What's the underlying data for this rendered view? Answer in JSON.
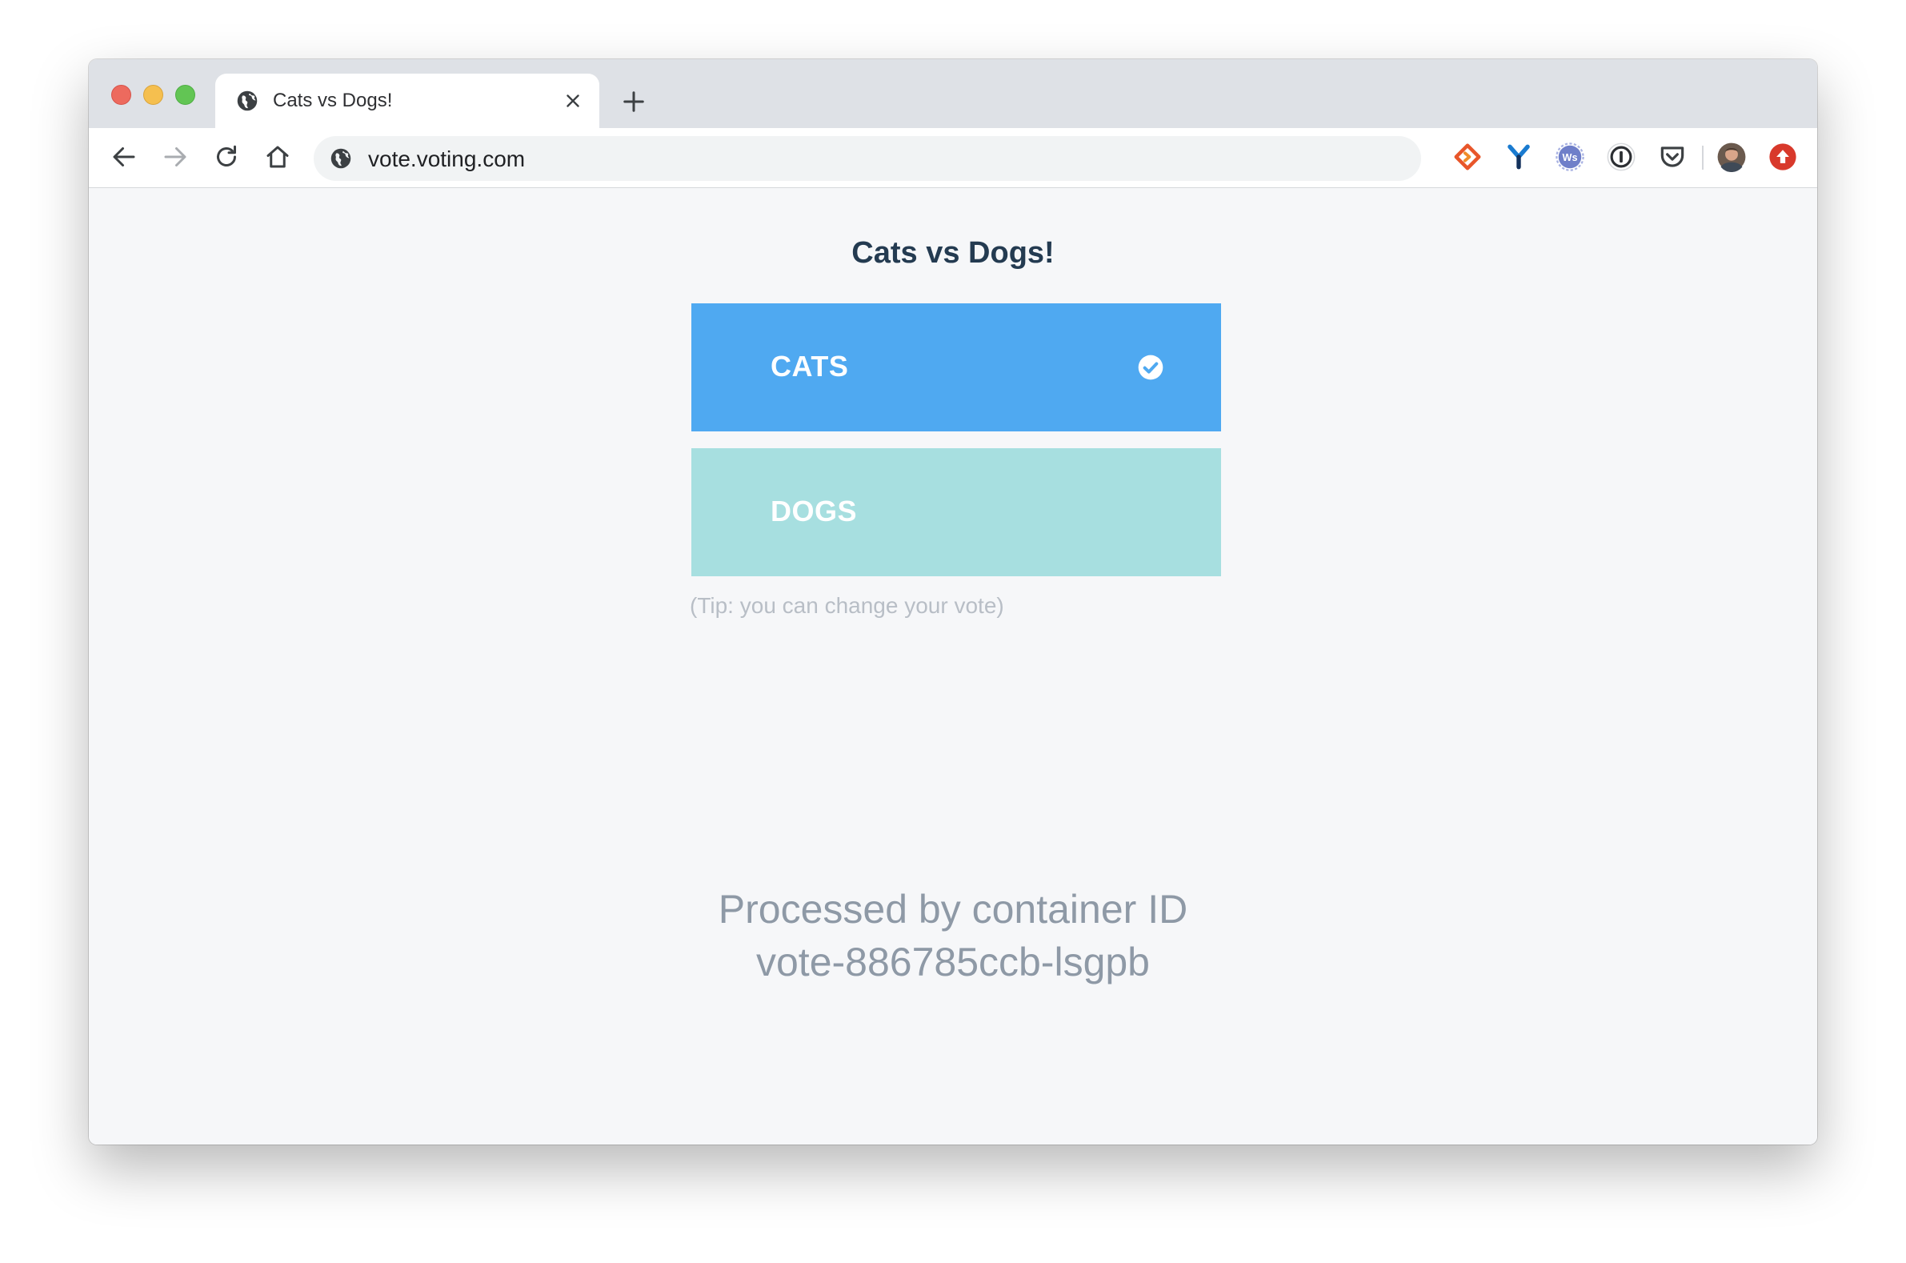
{
  "browser": {
    "tab_title": "Cats vs Dogs!",
    "url": "vote.voting.com",
    "icons": {
      "back": "arrow-left-icon",
      "forward": "arrow-right-icon",
      "reload": "reload-icon",
      "home": "home-icon",
      "new_tab": "plus-icon",
      "close_tab": "close-icon",
      "site": "globe-icon"
    },
    "extensions": [
      "orange-diamond-extension-icon",
      "blue-y-extension-icon",
      "ws-badge-extension-icon",
      "password-manager-extension-icon",
      "pocket-extension-icon",
      "profile-avatar",
      "red-upload-extension-icon"
    ]
  },
  "page": {
    "title": "Cats vs Dogs!",
    "options": [
      {
        "label": "CATS",
        "selected": true,
        "color": "#4fa9f1"
      },
      {
        "label": "DOGS",
        "selected": false,
        "color": "#a7dfe0"
      }
    ],
    "tip": "(Tip: you can change your vote)",
    "processed_line1": "Processed by container ID",
    "processed_line2": "vote-886785ccb-lsgpb"
  }
}
